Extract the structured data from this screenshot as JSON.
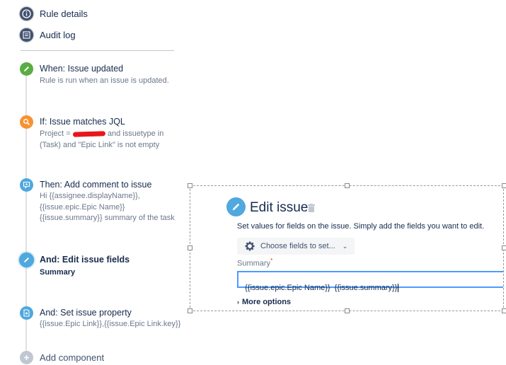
{
  "nav": {
    "rule_details": "Rule details",
    "audit_log": "Audit log"
  },
  "steps": [
    {
      "title": "When: Issue updated",
      "desc": [
        "Rule is run when an issue is updated."
      ],
      "icon": "pencil-icon",
      "color": "#5aac44"
    },
    {
      "title": "If: Issue matches JQL",
      "desc": [
        "Project =",
        "and issuetype in",
        "(Task) and \"Epic Link\" is not empty"
      ],
      "icon": "search-icon",
      "color": "#f79232"
    },
    {
      "title": "Then: Add comment to issue",
      "desc": [
        "Hi {{assignee.displayName}},",
        "{{issue.epic.Epic Name}}",
        "{{issue.summary}} summary of the task"
      ],
      "icon": "comment-icon",
      "color": "#4fa8de"
    },
    {
      "title": "And: Edit issue fields",
      "desc": [
        "Summary"
      ],
      "icon": "pencil-icon",
      "color": "#4fa8de"
    },
    {
      "title": "And: Set issue property",
      "desc": [
        "{{issue.Epic Link}},{{issue.Epic Link.key}}"
      ],
      "icon": "property-icon",
      "color": "#4fa8de"
    }
  ],
  "add_component": "Add component",
  "panel": {
    "title": "Edit issue",
    "description": "Set values for fields on the issue. Simply add the fields you want to edit.",
    "choose_fields": "Choose fields to set...",
    "summary_label": "Summary",
    "required_mark": "*",
    "summary_value": "{{issue.epic.Epic Name}}  {{issue.summary}}",
    "more_options": "More options"
  }
}
